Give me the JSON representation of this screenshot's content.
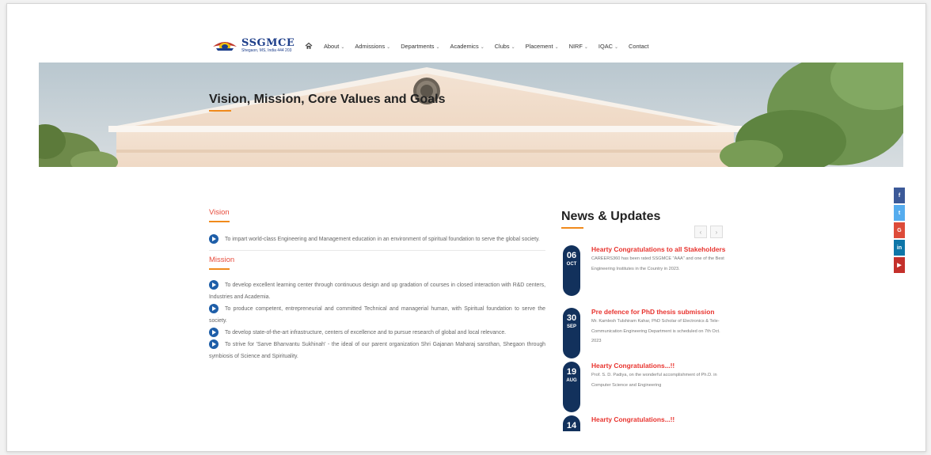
{
  "header": {
    "logo_name": "SSGMCE",
    "logo_sub": "Shegaon, MS, India 444 203",
    "nav": [
      {
        "label": "About",
        "dropdown": true
      },
      {
        "label": "Admissions",
        "dropdown": true
      },
      {
        "label": "Departments",
        "dropdown": true
      },
      {
        "label": "Academics",
        "dropdown": true
      },
      {
        "label": "Clubs",
        "dropdown": true
      },
      {
        "label": "Placement",
        "dropdown": true
      },
      {
        "label": "NIRF",
        "dropdown": true
      },
      {
        "label": "IQAC",
        "dropdown": true
      },
      {
        "label": "Contact",
        "dropdown": false
      }
    ],
    "caret": "⌄"
  },
  "banner": {
    "title": "Vision, Mission, Core Values and Goals"
  },
  "vision": {
    "heading": "Vision",
    "items": [
      "To impart world-class Engineering and Management education in an environment of spiritual foundation to serve the global society."
    ]
  },
  "mission": {
    "heading": "Mission",
    "items": [
      "To develop excellent learning center through continuous design and up gradation of courses in closed interaction with R&D centers, Industries and Academia.",
      "To produce competent, entrepreneurial and committed Technical and managerial human, with Spiritual foundation to serve the society.",
      "To develop state-of-the-art infrastructure, centers of excellence and to pursue research of global and local relevance.",
      "To strive for 'Sarve Bhanvantu Sukhinah' - the ideal of our parent organization Shri Gajanan Maharaj sansthan, Shegaon through symbiosis of Science and Spirituality."
    ]
  },
  "news": {
    "title": "News & Updates",
    "prev": "‹",
    "next": "›",
    "items": [
      {
        "day": "06",
        "month": "OCT",
        "headline": "Hearty Congratulations to all Stakeholders",
        "body": "CAREERS360 has been rated SSGMCE \"AAA\" and one of the Best Engineering Institutes in the Country in 2023."
      },
      {
        "day": "30",
        "month": "SEP",
        "headline": "Pre defence for PhD thesis submission",
        "body": "Mr. Kamlesh Tulshiram Kahar, PhD Scholar of Electronics & Tele-Communication Engineering Department is scheduled on 7th Oct. 2023"
      },
      {
        "day": "19",
        "month": "AUG",
        "headline": "Hearty Congratulations...!!",
        "body": "Prof. S. D. Padiya, on the wonderful accomplishment of Ph.D. in Computer Science and Engineering"
      },
      {
        "day": "14",
        "month": "",
        "headline": "Hearty Congratulations...!!",
        "body": ""
      }
    ]
  },
  "social": [
    {
      "icon": "facebook-icon",
      "glyph": "f",
      "color": "#3b5998"
    },
    {
      "icon": "twitter-icon",
      "glyph": "t",
      "color": "#55acee"
    },
    {
      "icon": "google-plus-icon",
      "glyph": "G",
      "color": "#dd4b39"
    },
    {
      "icon": "linkedin-icon",
      "glyph": "in",
      "color": "#0e76a8"
    },
    {
      "icon": "youtube-icon",
      "glyph": "▶",
      "color": "#c4302b"
    }
  ]
}
